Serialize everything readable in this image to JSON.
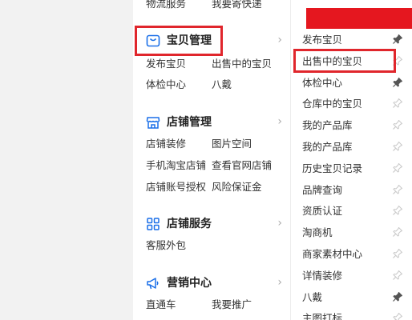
{
  "top_links": [
    "物流服务",
    "我要寄快递"
  ],
  "sections": [
    {
      "title": "宝贝管理",
      "icon": "shopping-bag-icon",
      "links": [
        "发布宝贝",
        "出售中的宝贝",
        "体检中心",
        "八戴"
      ]
    },
    {
      "title": "店铺管理",
      "icon": "storefront-icon",
      "links": [
        "店铺装修",
        "图片空间",
        "手机淘宝店铺",
        "查看官网店铺",
        "店铺账号授权",
        "风险保证金"
      ]
    },
    {
      "title": "店铺服务",
      "icon": "grid-apps-icon",
      "links": [
        "客服外包"
      ]
    },
    {
      "title": "营销中心",
      "icon": "megaphone-icon",
      "links": [
        "直通车",
        "我要推广"
      ]
    }
  ],
  "submenu": [
    {
      "label": "发布宝贝",
      "pinned": true
    },
    {
      "label": "出售中的宝贝",
      "pinned": false
    },
    {
      "label": "体检中心",
      "pinned": true
    },
    {
      "label": "仓库中的宝贝",
      "pinned": false
    },
    {
      "label": "我的产品库",
      "pinned": false
    },
    {
      "label": "我的产品库",
      "pinned": false
    },
    {
      "label": "历史宝贝记录",
      "pinned": false
    },
    {
      "label": "品牌查询",
      "pinned": false
    },
    {
      "label": "资质认证",
      "pinned": false
    },
    {
      "label": "淘商机",
      "pinned": false
    },
    {
      "label": "商家素材中心",
      "pinned": false
    },
    {
      "label": "详情装修",
      "pinned": false
    },
    {
      "label": "八戴",
      "pinned": true
    },
    {
      "label": "主图打标",
      "pinned": false
    }
  ],
  "colors": {
    "accent": "#1a6fe8",
    "highlight": "#e0262c",
    "banner": "#e5171f"
  }
}
